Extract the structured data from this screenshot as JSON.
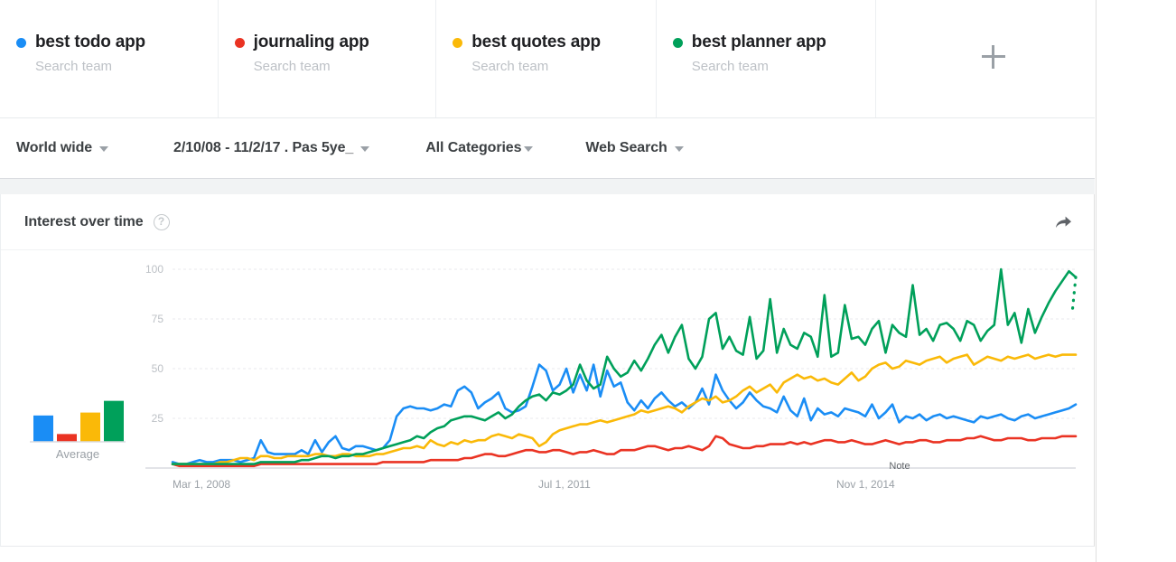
{
  "terms": [
    {
      "label": "best todo app",
      "sub": "Search team",
      "color": "#1a8df5",
      "dot": "legend-dot"
    },
    {
      "label": "journaling app",
      "sub": "Search team",
      "color": "#ea3323",
      "dot": "legend-dot"
    },
    {
      "label": "best quotes app",
      "sub": "Search team",
      "color": "#fab908",
      "dot": "legend-dot"
    },
    {
      "label": "best planner app",
      "sub": "Search team",
      "color": "#00a05a",
      "dot": "legend-dot"
    }
  ],
  "add_button": {
    "name": "add-term-button",
    "glyph": "+"
  },
  "filters": {
    "geo": "World wide",
    "date": "2/10/08 - 11/2/17 . Pas 5ye_",
    "category": "All Categories",
    "search_type": "Web Search"
  },
  "chart_panel": {
    "title": "Interest over time",
    "help_glyph": "?",
    "share_icon": "share-arrow-icon"
  },
  "chart_data": {
    "type": "line",
    "title": "Interest over time",
    "xlabel": "",
    "ylabel": "",
    "ylim": [
      0,
      100
    ],
    "grid": true,
    "legend_position": "top",
    "yticks": [
      100,
      75,
      50,
      25
    ],
    "xticks": [
      "Mar 1, 2008",
      "Jul 1, 2011",
      "Nov 1, 2014"
    ],
    "xtick_positions": [
      0,
      0.405,
      0.735
    ],
    "annotation": "Note",
    "annotation_position": [
      0.805,
      0.04
    ],
    "partial_data_dotted_tail": true,
    "series": [
      {
        "name": "best todo app",
        "color": "#1a8df5",
        "values": [
          3,
          2,
          2,
          3,
          4,
          3,
          3,
          4,
          4,
          4,
          3,
          4,
          5,
          14,
          8,
          7,
          7,
          7,
          7,
          9,
          7,
          14,
          8,
          13,
          16,
          10,
          9,
          11,
          11,
          10,
          9,
          10,
          14,
          26,
          30,
          31,
          30,
          30,
          29,
          30,
          32,
          31,
          39,
          41,
          38,
          30,
          33,
          35,
          38,
          30,
          28,
          29,
          31,
          41,
          52,
          49,
          39,
          42,
          50,
          38,
          47,
          39,
          52,
          36,
          49,
          41,
          43,
          33,
          29,
          34,
          30,
          35,
          38,
          34,
          31,
          33,
          30,
          33,
          40,
          32,
          47,
          39,
          34,
          30,
          33,
          38,
          34,
          31,
          30,
          28,
          36,
          29,
          26,
          35,
          24,
          30,
          27,
          28,
          26,
          30,
          29,
          28,
          26,
          32,
          25,
          28,
          32,
          23,
          26,
          25,
          27,
          24,
          26,
          27,
          25,
          26,
          25,
          24,
          23,
          26,
          25,
          26,
          27,
          25,
          24,
          26,
          27,
          25,
          26,
          27,
          28,
          29,
          30,
          32
        ]
      },
      {
        "name": "journaling app",
        "color": "#ea3323",
        "values": [
          2,
          1,
          1,
          1,
          1,
          1,
          1,
          1,
          1,
          1,
          1,
          1,
          1,
          2,
          2,
          2,
          2,
          2,
          2,
          2,
          2,
          2,
          2,
          2,
          2,
          2,
          2,
          2,
          2,
          2,
          2,
          3,
          3,
          3,
          3,
          3,
          3,
          3,
          4,
          4,
          4,
          4,
          4,
          5,
          5,
          6,
          7,
          7,
          6,
          6,
          7,
          8,
          9,
          9,
          8,
          8,
          9,
          9,
          8,
          7,
          8,
          8,
          9,
          8,
          7,
          7,
          9,
          9,
          9,
          10,
          11,
          11,
          10,
          9,
          10,
          10,
          11,
          10,
          9,
          11,
          16,
          15,
          12,
          11,
          10,
          10,
          11,
          11,
          12,
          12,
          12,
          13,
          12,
          13,
          12,
          13,
          14,
          14,
          13,
          13,
          14,
          13,
          12,
          12,
          13,
          14,
          13,
          12,
          13,
          13,
          14,
          14,
          13,
          13,
          14,
          14,
          14,
          15,
          15,
          16,
          15,
          14,
          14,
          15,
          15,
          15,
          14,
          14,
          15,
          15,
          15,
          16,
          16,
          16
        ]
      },
      {
        "name": "best quotes app",
        "color": "#fab908",
        "values": [
          2,
          2,
          2,
          2,
          2,
          2,
          2,
          3,
          3,
          4,
          5,
          5,
          4,
          6,
          6,
          5,
          5,
          6,
          6,
          6,
          6,
          7,
          7,
          6,
          6,
          7,
          7,
          6,
          6,
          6,
          7,
          7,
          8,
          9,
          10,
          10,
          11,
          10,
          14,
          12,
          11,
          13,
          12,
          14,
          13,
          14,
          14,
          16,
          17,
          16,
          15,
          17,
          16,
          15,
          11,
          13,
          17,
          19,
          20,
          21,
          22,
          22,
          23,
          24,
          23,
          24,
          25,
          26,
          27,
          29,
          28,
          29,
          30,
          31,
          30,
          28,
          31,
          33,
          35,
          34,
          36,
          33,
          34,
          36,
          39,
          41,
          38,
          40,
          42,
          38,
          43,
          45,
          47,
          45,
          46,
          44,
          45,
          43,
          42,
          45,
          48,
          44,
          46,
          50,
          52,
          53,
          50,
          51,
          54,
          53,
          52,
          54,
          55,
          56,
          53,
          55,
          56,
          57,
          52,
          54,
          56,
          55,
          54,
          56,
          55,
          56,
          57,
          55,
          56,
          57,
          56,
          57,
          57,
          57
        ]
      },
      {
        "name": "best planner app",
        "color": "#00a05a",
        "values": [
          2,
          2,
          2,
          2,
          2,
          2,
          2,
          2,
          2,
          2,
          2,
          2,
          2,
          3,
          3,
          3,
          3,
          3,
          3,
          4,
          4,
          5,
          6,
          6,
          5,
          6,
          6,
          7,
          7,
          8,
          9,
          10,
          11,
          12,
          13,
          14,
          16,
          15,
          18,
          20,
          21,
          24,
          25,
          26,
          26,
          25,
          24,
          26,
          28,
          25,
          27,
          31,
          34,
          36,
          37,
          34,
          38,
          37,
          39,
          42,
          52,
          44,
          40,
          42,
          56,
          50,
          46,
          48,
          54,
          49,
          55,
          62,
          67,
          58,
          66,
          72,
          55,
          50,
          56,
          75,
          78,
          60,
          66,
          59,
          57,
          76,
          55,
          59,
          85,
          58,
          70,
          62,
          60,
          68,
          66,
          56,
          87,
          56,
          58,
          82,
          65,
          66,
          62,
          70,
          74,
          58,
          72,
          68,
          66,
          92,
          67,
          70,
          64,
          72,
          73,
          70,
          64,
          74,
          72,
          64,
          69,
          72,
          100,
          72,
          78,
          63,
          80,
          68,
          76,
          83,
          89,
          94,
          99,
          96
        ]
      }
    ],
    "average_bars": {
      "label": "Average",
      "categories": [
        "best todo app",
        "journaling app",
        "best quotes app",
        "best planner app"
      ],
      "values": [
        27,
        8,
        30,
        42
      ],
      "colors": [
        "#1a8df5",
        "#ea3323",
        "#fab908",
        "#00a05a"
      ]
    }
  }
}
